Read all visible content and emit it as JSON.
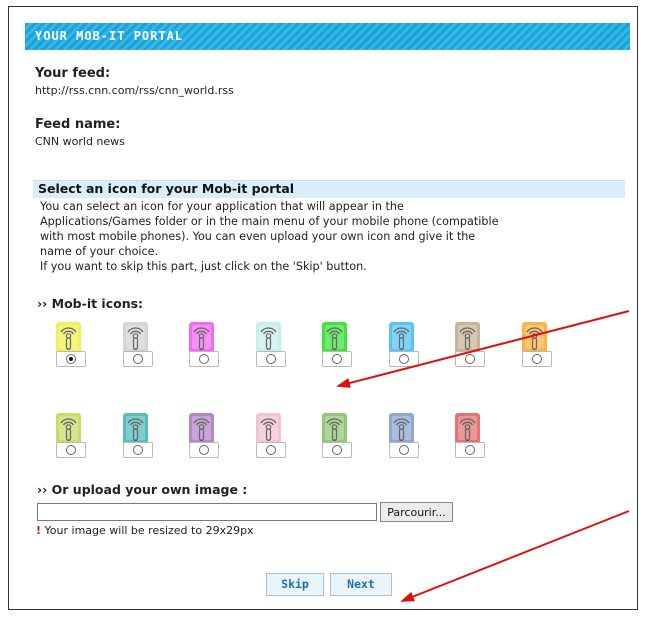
{
  "banner": {
    "title": "YOUR MOB-IT PORTAL"
  },
  "feed": {
    "label": "Your feed:",
    "url": "http://rss.cnn.com/rss/cnn_world.rss"
  },
  "feed_name": {
    "label": "Feed name:",
    "value": "CNN world news"
  },
  "icon_section": {
    "heading": "Select an icon for your Mob-it portal",
    "line1": "You can select an icon for your application that will appear in the",
    "line2": "Applications/Games folder or in the main menu of your mobile phone (compatible",
    "line3": "with most mobile phones). You can even upload your own icon and give it the",
    "line4": "name of your choice.",
    "line5": "If you want to skip this part, just click on the 'Skip' button."
  },
  "mobit_icons": {
    "heading": "›› Mob-it icons:",
    "icons": [
      {
        "color": "#f0f05a",
        "selected": true
      },
      {
        "color": "#d5d5d5",
        "selected": false
      },
      {
        "color": "#f06cf0",
        "selected": false
      },
      {
        "color": "#c4f0ea",
        "selected": false
      },
      {
        "color": "#3fe23f",
        "selected": false
      },
      {
        "color": "#58c4f4",
        "selected": false
      },
      {
        "color": "#c8b49a",
        "selected": false
      },
      {
        "color": "#f8b445",
        "selected": false
      },
      {
        "color": "#c8dc6a",
        "selected": false
      },
      {
        "color": "#56bcbc",
        "selected": false
      },
      {
        "color": "#b587c8",
        "selected": false
      },
      {
        "color": "#f4c2d2",
        "selected": false
      },
      {
        "color": "#94c878",
        "selected": false
      },
      {
        "color": "#90a8d0",
        "selected": false
      },
      {
        "color": "#e27474",
        "selected": false
      }
    ]
  },
  "upload": {
    "heading": "›› Or upload your own image :",
    "browse_label": "Parcourir...",
    "hint_mark": "!",
    "hint": "Your image will be resized to 29x29px"
  },
  "buttons": {
    "skip": "Skip",
    "next": "Next"
  }
}
